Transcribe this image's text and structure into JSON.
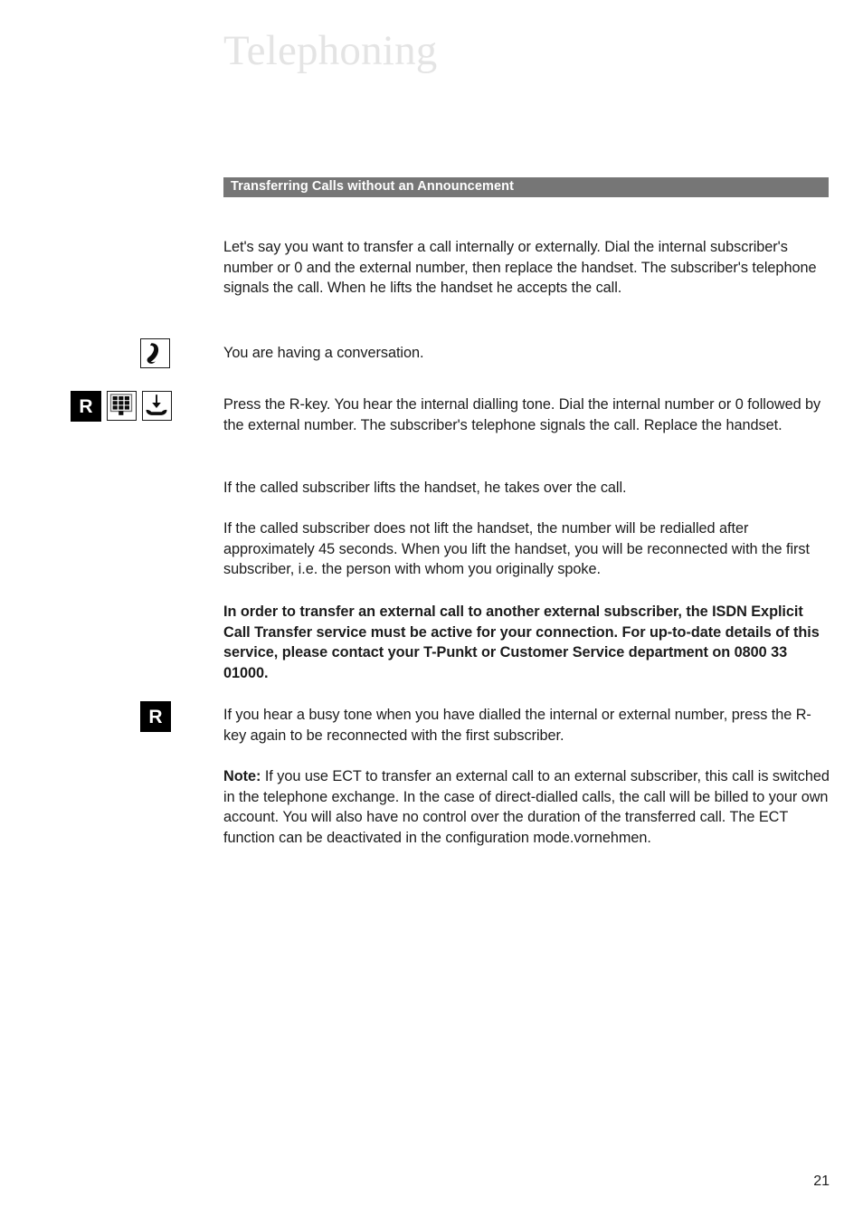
{
  "document": {
    "chapter_title": "Telephoning",
    "page_number": "21"
  },
  "section": {
    "heading": "Transferring Calls without an Announcement",
    "bar_color": "#767676",
    "heading_color": "#ffffff"
  },
  "content": {
    "intro": "Let's say you want to transfer a call internally or externally. Dial the internal subscriber's number or 0 and the external number, then replace the handset. The subscriber's telephone signals the call. When he lifts the handset he accepts the call.",
    "conversation": "You are having a conversation.",
    "press_r_key": "Press the R-key. You hear the internal dialling tone. Dial the internal number or 0 followed by the external number. The subscriber's telephone signals the call. Replace the handset.",
    "subscriber_lifts": "If the called subscriber lifts the handset, he takes over the call.",
    "subscriber_not_lift": "If the called subscriber does not lift the handset, the number will be redialled after approximately 45 seconds. When you lift the handset, you will be reconnected with the first subscriber, i.e. the person with whom you originally spoke.",
    "isdn_notice": "In order to transfer an external call to another external subscriber, the ISDN Explicit Call Transfer service must be active for your connection. For up-to-date details of this service, please contact your T-Punkt or Customer Service department on 0800 33 01000.",
    "busy_tone": "If you hear a busy tone when you have dialled the internal or external number, press the R-key again to be reconnected with the first subscriber.",
    "note_label": "Note:",
    "note_text": " If you use ECT to transfer an external call to an external subscriber, this call is switched in the telephone exchange. In the case of direct-dialled calls, the call will be billed to your own account. You will also have no control over the duration of the transferred call. The ECT function can be deactivated in the configuration mode.vornehmen."
  },
  "icons": {
    "handset_lifted": "handset-lifted-icon",
    "r_key": "r-key-icon",
    "r_key_label": "R",
    "keypad": "keypad-icon",
    "handset_replace": "handset-replace-icon"
  }
}
